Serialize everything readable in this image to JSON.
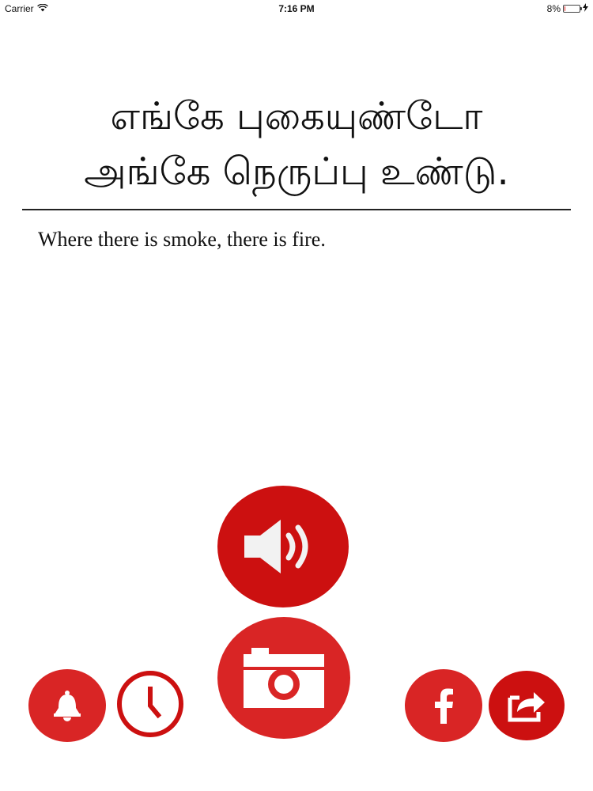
{
  "status_bar": {
    "carrier": "Carrier",
    "time": "7:16 PM",
    "battery_percent_label": "8%",
    "battery_level": 0.08,
    "icons": [
      "wifi-icon",
      "battery-icon",
      "charging-bolt-icon"
    ]
  },
  "proverb": {
    "tamil_line1": "எங்கே புகையுண்டோ",
    "tamil_line2": "அங்கே நெருப்பு உண்டு.",
    "english": "Where there is smoke, there is fire."
  },
  "buttons": {
    "sound": {
      "icon": "speaker-icon"
    },
    "camera": {
      "icon": "camera-icon"
    },
    "bell": {
      "icon": "bell-icon"
    },
    "clock": {
      "icon": "clock-icon"
    },
    "facebook": {
      "icon": "facebook-icon"
    },
    "share": {
      "icon": "share-icon"
    }
  },
  "colors": {
    "accent_red": "#cc1010",
    "accent_red_light": "#d92525",
    "text": "#111111",
    "background": "#ffffff"
  }
}
